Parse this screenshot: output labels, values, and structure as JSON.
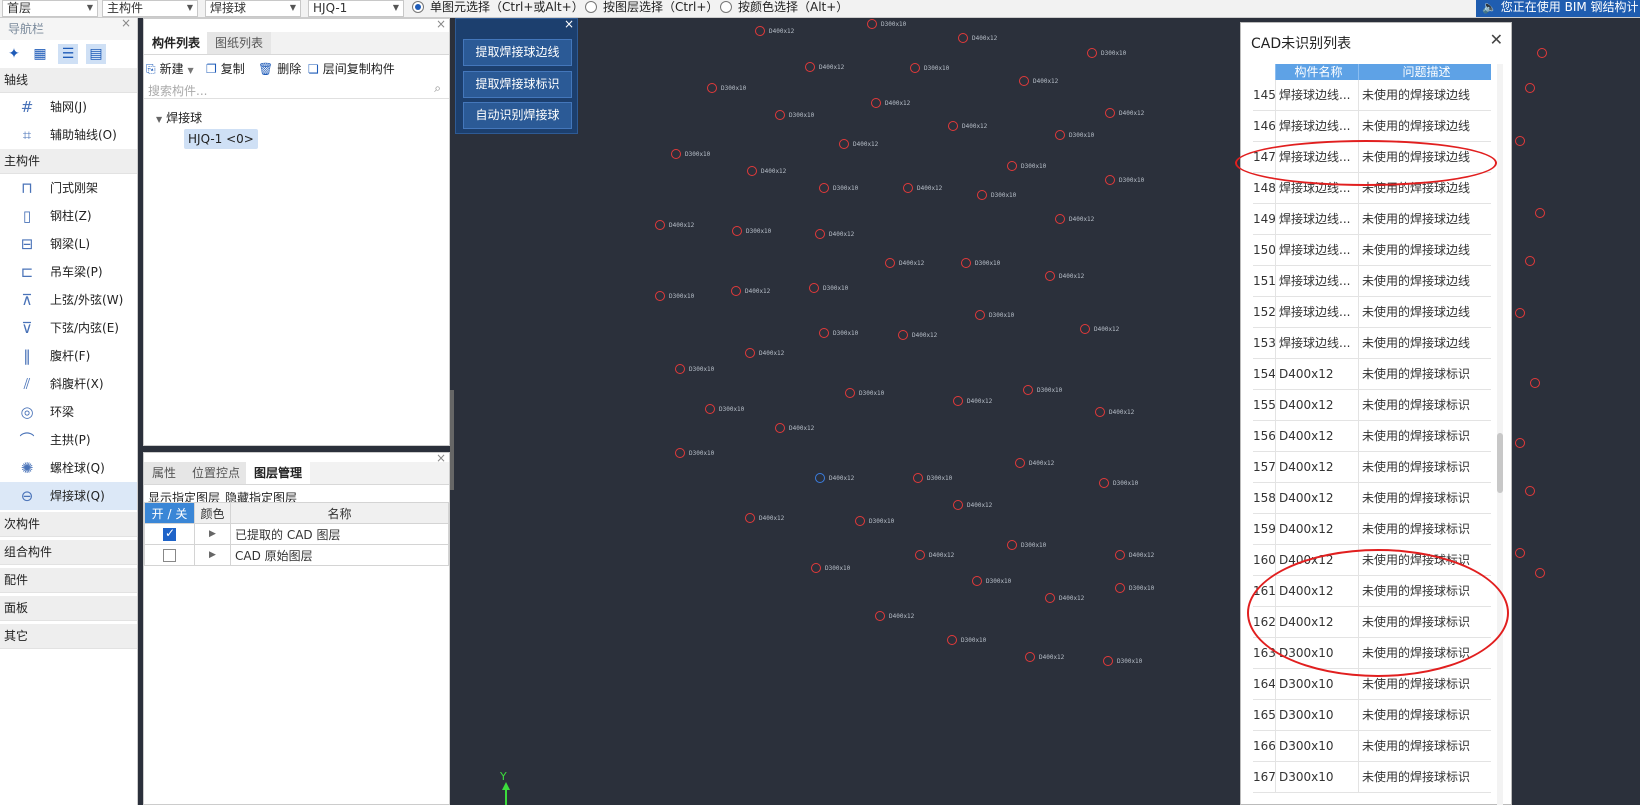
{
  "toolbar": {
    "floor": "首层",
    "category": "主构件",
    "type": "焊接球",
    "component": "HJQ-1",
    "select_modes": [
      {
        "label": "单图元选择（Ctrl+或Alt+）",
        "selected": true
      },
      {
        "label": "按图层选择（Ctrl+）",
        "selected": false
      },
      {
        "label": "按颜色选择（Alt+）",
        "selected": false
      }
    ],
    "bim_notice": "您正在使用 BIM 钢结构计"
  },
  "nav": {
    "title": "导航栏",
    "categories": {
      "axis": "轴线",
      "main": "主构件",
      "secondary": "次构件",
      "combo": "组合构件",
      "fitting": "配件",
      "panel": "面板",
      "other": "其它"
    },
    "axis_items": [
      {
        "label": "轴网(J)",
        "icon": "grid-icon"
      },
      {
        "label": "辅助轴线(O)",
        "icon": "aux-axis-icon"
      }
    ],
    "main_items": [
      {
        "label": "门式刚架",
        "icon": "portal-frame-icon"
      },
      {
        "label": "钢柱(Z)",
        "icon": "steel-column-icon"
      },
      {
        "label": "钢梁(L)",
        "icon": "steel-beam-icon"
      },
      {
        "label": "吊车梁(P)",
        "icon": "crane-beam-icon"
      },
      {
        "label": "上弦/外弦(W)",
        "icon": "upper-chord-icon"
      },
      {
        "label": "下弦/内弦(E)",
        "icon": "lower-chord-icon"
      },
      {
        "label": "腹杆(F)",
        "icon": "web-member-icon"
      },
      {
        "label": "斜腹杆(X)",
        "icon": "diagonal-web-icon"
      },
      {
        "label": "环梁",
        "icon": "ring-beam-icon"
      },
      {
        "label": "主拱(P)",
        "icon": "main-arch-icon"
      },
      {
        "label": "螺栓球(Q)",
        "icon": "bolt-ball-icon"
      },
      {
        "label": "焊接球(Q)",
        "icon": "weld-ball-icon"
      }
    ]
  },
  "component_panel": {
    "tabs": [
      "构件列表",
      "图纸列表"
    ],
    "new": "新建",
    "copy": "复制",
    "delete": "删除",
    "floor_copy": "层间复制构件",
    "search_placeholder": "搜索构件...",
    "tree_root": "焊接球",
    "tree_leaf": "HJQ-1 <0>"
  },
  "layer_panel": {
    "tabs": [
      "属性",
      "位置控点",
      "图层管理"
    ],
    "show_layer": "显示指定图层",
    "hide_layer": "隐藏指定图层",
    "headers": [
      "开 / 关",
      "颜色",
      "名称"
    ],
    "rows": [
      {
        "checked": true,
        "name": "已提取的 CAD 图层"
      },
      {
        "checked": false,
        "name": "CAD 原始图层"
      }
    ]
  },
  "float_tool": {
    "buttons": [
      "提取焊接球边线",
      "提取焊接球标识",
      "自动识别焊接球"
    ]
  },
  "cad_list": {
    "title": "CAD未识别列表",
    "headers": [
      "构件名称",
      "问题描述"
    ],
    "rows": [
      {
        "n": "145",
        "name": "焊接球边线...",
        "desc": "未使用的焊接球边线"
      },
      {
        "n": "146",
        "name": "焊接球边线...",
        "desc": "未使用的焊接球边线"
      },
      {
        "n": "147",
        "name": "焊接球边线...",
        "desc": "未使用的焊接球边线"
      },
      {
        "n": "148",
        "name": "焊接球边线...",
        "desc": "未使用的焊接球边线"
      },
      {
        "n": "149",
        "name": "焊接球边线...",
        "desc": "未使用的焊接球边线"
      },
      {
        "n": "150",
        "name": "焊接球边线...",
        "desc": "未使用的焊接球边线"
      },
      {
        "n": "151",
        "name": "焊接球边线...",
        "desc": "未使用的焊接球边线"
      },
      {
        "n": "152",
        "name": "焊接球边线...",
        "desc": "未使用的焊接球边线"
      },
      {
        "n": "153",
        "name": "焊接球边线...",
        "desc": "未使用的焊接球边线"
      },
      {
        "n": "154",
        "name": "D400x12",
        "desc": "未使用的焊接球标识"
      },
      {
        "n": "155",
        "name": "D400x12",
        "desc": "未使用的焊接球标识"
      },
      {
        "n": "156",
        "name": "D400x12",
        "desc": "未使用的焊接球标识"
      },
      {
        "n": "157",
        "name": "D400x12",
        "desc": "未使用的焊接球标识"
      },
      {
        "n": "158",
        "name": "D400x12",
        "desc": "未使用的焊接球标识"
      },
      {
        "n": "159",
        "name": "D400x12",
        "desc": "未使用的焊接球标识"
      },
      {
        "n": "160",
        "name": "D400x12",
        "desc": "未使用的焊接球标识"
      },
      {
        "n": "161",
        "name": "D400x12",
        "desc": "未使用的焊接球标识"
      },
      {
        "n": "162",
        "name": "D400x12",
        "desc": "未使用的焊接球标识"
      },
      {
        "n": "163",
        "name": "D300x10",
        "desc": "未使用的焊接球标识"
      },
      {
        "n": "164",
        "name": "D300x10",
        "desc": "未使用的焊接球标识"
      },
      {
        "n": "165",
        "name": "D300x10",
        "desc": "未使用的焊接球标识"
      },
      {
        "n": "166",
        "name": "D300x10",
        "desc": "未使用的焊接球标识"
      },
      {
        "n": "167",
        "name": "D300x10",
        "desc": "未使用的焊接球标识"
      }
    ]
  },
  "canvas": {
    "axis_label": "Y",
    "ball_labels": [
      "D400x12",
      "D300x10"
    ]
  },
  "colors": {
    "accent": "#1e5bb8",
    "canvas_bg": "#2b303b",
    "ball": "#e23a3a",
    "annotation": "#e11f1f"
  }
}
